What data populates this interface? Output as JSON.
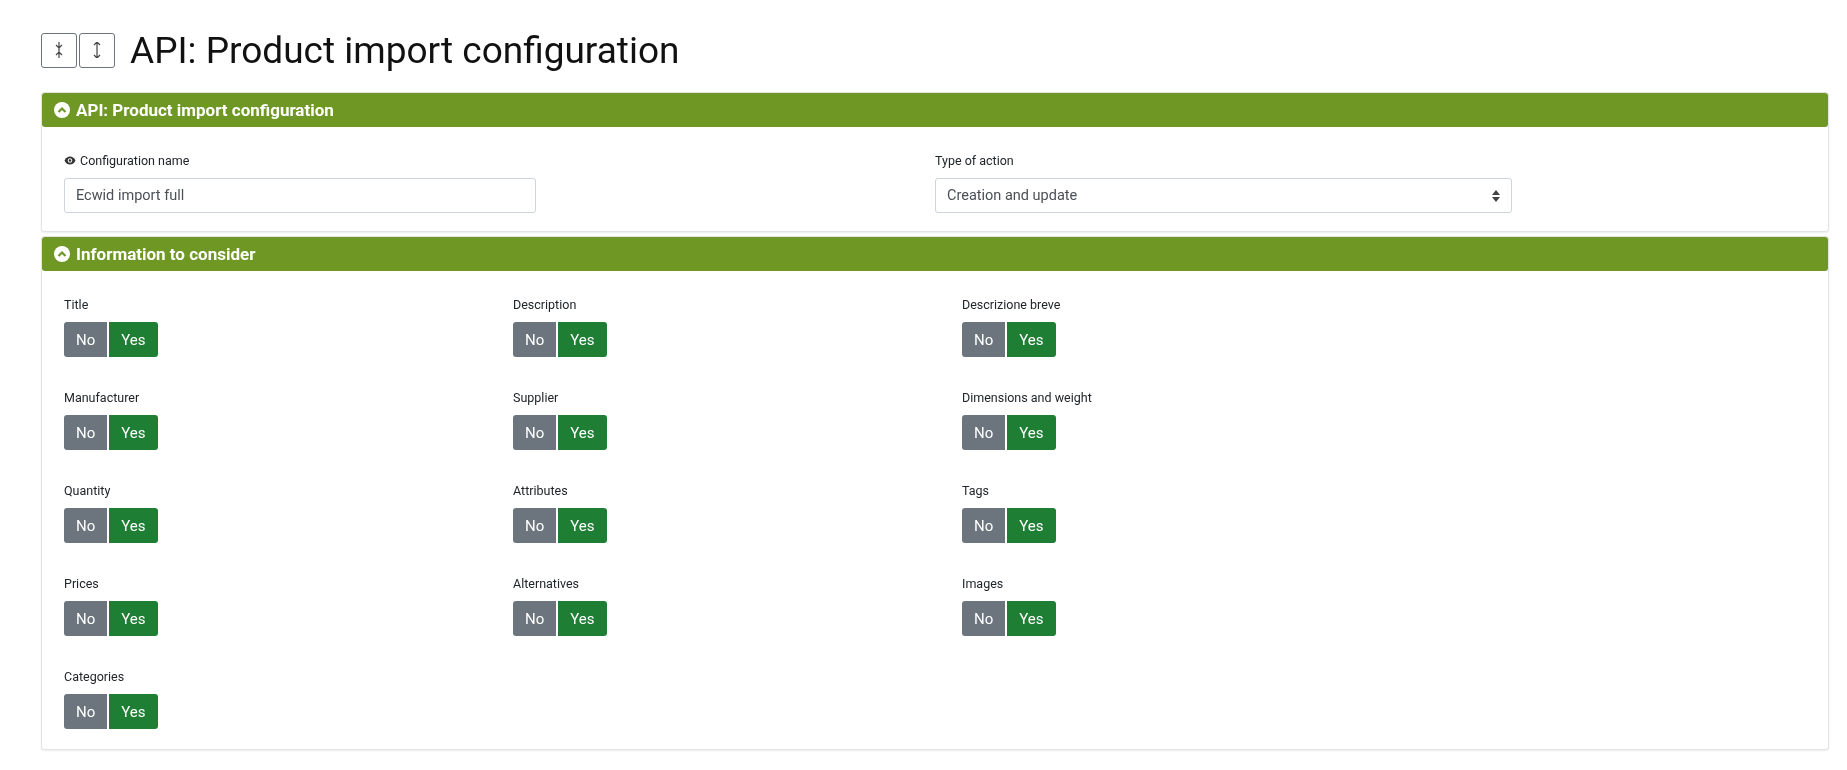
{
  "page_title": "API: Product import configuration",
  "sections": [
    {
      "title": "API: Product import configuration",
      "expanded": true,
      "kind": "form",
      "fields": [
        {
          "kind": "text",
          "label": "Configuration name",
          "value": "Ecwid import full"
        },
        {
          "kind": "select",
          "label": "Type of action",
          "value": "Creation and update"
        }
      ]
    },
    {
      "title": "Information to consider",
      "expanded": true,
      "kind": "toggles",
      "toggles": [
        {
          "label": "Title",
          "options": [
            {
              "label": "No",
              "selected": false
            },
            {
              "label": "Yes",
              "selected": true
            }
          ]
        },
        {
          "label": "Description",
          "options": [
            {
              "label": "No",
              "selected": false
            },
            {
              "label": "Yes",
              "selected": true
            }
          ]
        },
        {
          "label": "Descrizione breve",
          "options": [
            {
              "label": "No",
              "selected": false
            },
            {
              "label": "Yes",
              "selected": true
            }
          ]
        },
        {
          "label": "Manufacturer",
          "options": [
            {
              "label": "No",
              "selected": false
            },
            {
              "label": "Yes",
              "selected": true
            }
          ]
        },
        {
          "label": "Supplier",
          "options": [
            {
              "label": "No",
              "selected": false
            },
            {
              "label": "Yes",
              "selected": true
            }
          ]
        },
        {
          "label": "Dimensions and weight",
          "options": [
            {
              "label": "No",
              "selected": false
            },
            {
              "label": "Yes",
              "selected": true
            }
          ]
        },
        {
          "label": "Quantity",
          "options": [
            {
              "label": "No",
              "selected": false
            },
            {
              "label": "Yes",
              "selected": true
            }
          ]
        },
        {
          "label": "Attributes",
          "options": [
            {
              "label": "No",
              "selected": false
            },
            {
              "label": "Yes",
              "selected": true
            }
          ]
        },
        {
          "label": "Tags",
          "options": [
            {
              "label": "No",
              "selected": false
            },
            {
              "label": "Yes",
              "selected": true
            }
          ]
        },
        {
          "label": "Prices",
          "options": [
            {
              "label": "No",
              "selected": false
            },
            {
              "label": "Yes",
              "selected": true
            }
          ]
        },
        {
          "label": "Alternatives",
          "options": [
            {
              "label": "No",
              "selected": false
            },
            {
              "label": "Yes",
              "selected": true
            }
          ]
        },
        {
          "label": "Images",
          "options": [
            {
              "label": "No",
              "selected": false
            },
            {
              "label": "Yes",
              "selected": true
            }
          ]
        },
        {
          "label": "Categories",
          "options": [
            {
              "label": "No",
              "selected": false
            },
            {
              "label": "Yes",
              "selected": true
            }
          ]
        }
      ]
    }
  ]
}
